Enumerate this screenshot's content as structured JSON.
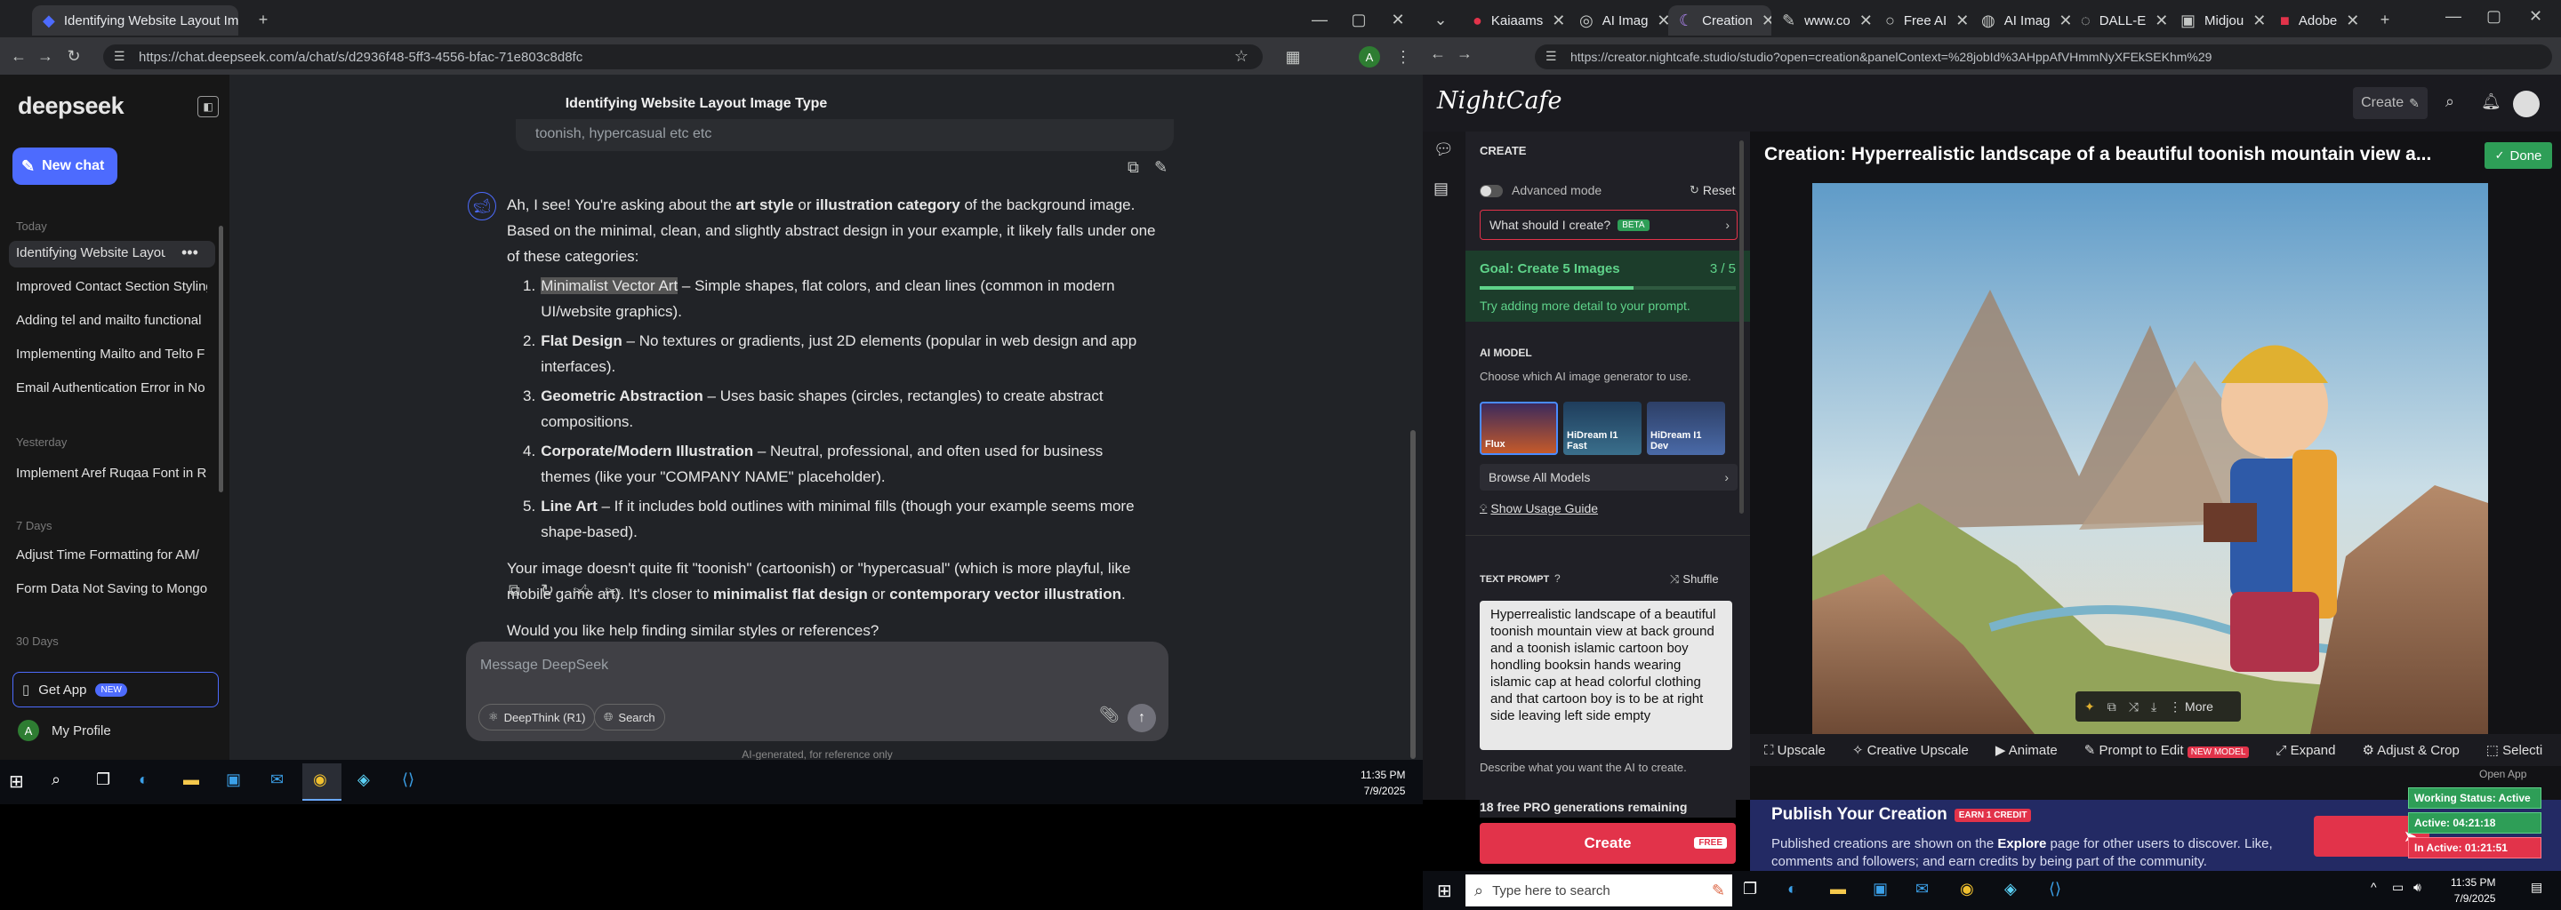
{
  "left_browser": {
    "tabs": [
      {
        "label": "Identifying Website Layout Ima"
      }
    ],
    "url": "https://chat.deepseek.com/a/chat/s/d2936f48-5ff3-4556-bfac-71e803c8d8fc"
  },
  "deepseek": {
    "logo": "deepseek",
    "new_chat": "New chat",
    "groups": {
      "today": "Today",
      "yesterday": "Yesterday",
      "d7": "7 Days",
      "d30": "30 Days"
    },
    "today_items": [
      "Identifying Website Layout",
      "Improved Contact Section Styling",
      "Adding tel and mailto functional",
      "Implementing Mailto and Telto F",
      "Email Authentication Error in No"
    ],
    "yesterday_items": [
      "Implement Aref Ruqaa Font in R"
    ],
    "week_items": [
      "Adjust Time Formatting for AM/",
      "Form Data Not Saving to Mongo"
    ],
    "get_app": "Get App",
    "new_badge": "NEW",
    "profile": "My Profile",
    "avatar": "A",
    "chat_title": "Identifying Website Layout Image Type",
    "prev_bubble": "toonish, hypercasual etc etc",
    "intro_a": "Ah, I see! You're asking about the ",
    "intro_b": "art style",
    "intro_c": " or ",
    "intro_d": "illustration category",
    "intro_e": " of the background image. Based on the minimal, clean, and slightly abstract design in your example, it likely falls under one of these categories:",
    "list": [
      {
        "n": "1.",
        "b": "Minimalist Vector Art",
        "t": " – Simple shapes, flat colors, and clean lines (common in modern UI/website graphics)."
      },
      {
        "n": "2.",
        "b": "Flat Design",
        "t": " – No textures or gradients, just 2D elements (popular in web design and app interfaces)."
      },
      {
        "n": "3.",
        "b": "Geometric Abstraction",
        "t": " – Uses basic shapes (circles, rectangles) to create abstract compositions."
      },
      {
        "n": "4.",
        "b": "Corporate/Modern Illustration",
        "t": " – Neutral, professional, and often used for business themes (like your \"COMPANY NAME\" placeholder)."
      },
      {
        "n": "5.",
        "b": "Line Art",
        "t": " – If it includes bold outlines with minimal fills (though your example seems more shape-based)."
      }
    ],
    "para_a": "Your image doesn't quite fit \"toonish\" (cartoonish) or \"hypercasual\" (which is more playful, like mobile game art). It's closer to ",
    "para_b": "minimalist flat design",
    "para_c": " or ",
    "para_d": "contemporary vector illustration",
    "para_e": ".",
    "question": "Would you like help finding similar styles or references?",
    "input_placeholder": "Message DeepSeek",
    "deepthink": "DeepThink (R1)",
    "search": "Search",
    "disclaimer": "AI-generated, for reference only"
  },
  "left_clock": {
    "time": "11:35 PM",
    "date": "7/9/2025"
  },
  "right_browser": {
    "tabs": [
      "Kaiaams",
      "AI Imag",
      "Creation",
      "www.co",
      "Free AI",
      "AI Imag",
      "DALL-E",
      "Midjou",
      "Adobe"
    ],
    "url": "https://creator.nightcafe.studio/studio?open=creation&panelContext=%28jobId%3AHppAfVHmmNyXFEkSEKhm%29"
  },
  "nightcafe": {
    "logo": "NightCafe",
    "create_btn": "Create",
    "create_head": "CREATE",
    "advanced": "Advanced mode",
    "reset": "Reset",
    "what_create": "What should I create?",
    "beta": "BETA",
    "goal_title": "Goal: Create 5 Images",
    "goal_count": "3 / 5",
    "goal_progress": 0.6,
    "goal_hint": "Try adding more detail to your prompt.",
    "ai_model": "AI MODEL",
    "ai_model_desc": "Choose which AI image generator to use.",
    "models": [
      "Flux",
      "HiDream I1 Fast",
      "HiDream I1 Dev"
    ],
    "browse": "Browse All Models",
    "usage": "Show Usage Guide",
    "prompt_label": "TEXT PROMPT",
    "shuffle": "Shuffle",
    "prompt": "Hyperrealistic landscape of a beautiful toonish mountain view at back ground and a toonish islamic cartoon boy hondling booksin hands wearing islamic cap at head colorful clothing and that cartoon boy is to be at right side leaving left side empty",
    "prompt_desc": "Describe what you want the AI to create.",
    "free_pro": "18 free PRO generations remaining",
    "create_main": "Create",
    "free_badge": "FREE",
    "creation_title": "Creation: Hyperrealistic landscape of a beautiful toonish mountain view a...",
    "done": "Done",
    "more": "More",
    "tools": [
      "Upscale",
      "Creative Upscale",
      "Animate",
      "Prompt to Edit",
      "Expand",
      "Adjust & Crop",
      "Selecti"
    ],
    "new_model": "NEW MODEL",
    "open_app": "Open App",
    "publish_title": "Publish Your Creation",
    "earn": "EARN 1 CREDIT",
    "publish_a": "Published creations are shown on the ",
    "publish_b": "Explore",
    "publish_c": " page for other users to discover. Like, comments and followers; and earn credits by being part of the community.",
    "status_working": "Working Status: Active",
    "status_active": "Active: 04:21:18",
    "status_inactive": "In Active: 01:21:51"
  },
  "right_clock": {
    "time": "11:35 PM",
    "date": "7/9/2025"
  },
  "right_taskbar": {
    "search_placeholder": "Type here to search"
  },
  "colors": {
    "deepseek_blue": "#4d6bfe",
    "nightcafe_green": "#2e9e57",
    "nightcafe_red": "#e2334a",
    "taskbar": "#0b0d12"
  }
}
